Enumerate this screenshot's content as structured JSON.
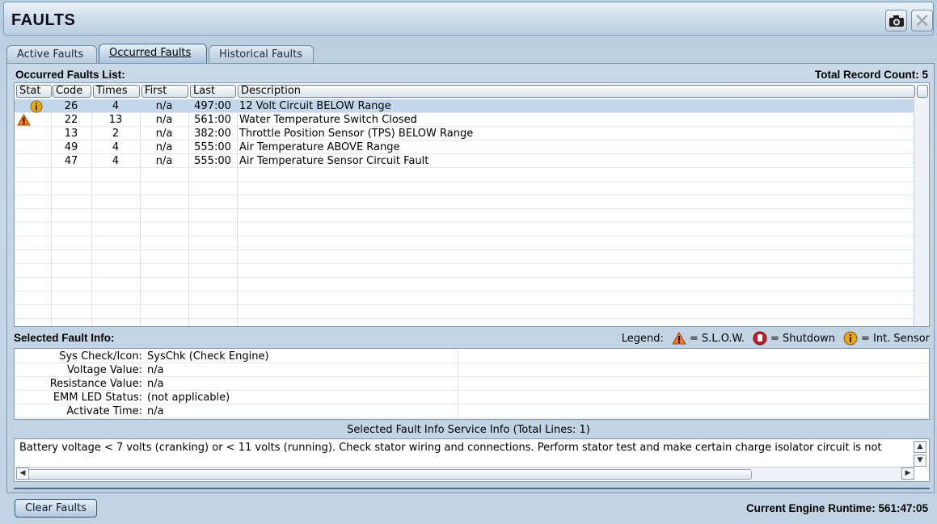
{
  "window": {
    "title": "FAULTS",
    "camera_icon": "camera-icon",
    "close_icon": "close-icon"
  },
  "tabs": [
    {
      "label": "Active Faults",
      "active": false
    },
    {
      "label": "Occurred Faults",
      "active": true
    },
    {
      "label": "Historical Faults",
      "active": false
    }
  ],
  "list": {
    "label": "Occurred Faults List:",
    "total_record_count": "Total Record Count: 5",
    "columns": [
      "Stat",
      "Code",
      "Times",
      "First",
      "Last",
      "Description"
    ],
    "rows": [
      {
        "stat_icon": "int-sensor-icon",
        "code": "26",
        "times": "4",
        "first": "n/a",
        "last": "497:00",
        "description": "12 Volt Circuit BELOW Range",
        "selected": true
      },
      {
        "stat_icon": "slow-warning-icon",
        "code": "22",
        "times": "13",
        "first": "n/a",
        "last": "561:00",
        "description": "Water Temperature Switch Closed",
        "selected": false
      },
      {
        "stat_icon": "",
        "code": "13",
        "times": "2",
        "first": "n/a",
        "last": "382:00",
        "description": "Throttle Position Sensor (TPS) BELOW Range",
        "selected": false
      },
      {
        "stat_icon": "",
        "code": "49",
        "times": "4",
        "first": "n/a",
        "last": "555:00",
        "description": "Air Temperature ABOVE Range",
        "selected": false
      },
      {
        "stat_icon": "",
        "code": "47",
        "times": "4",
        "first": "n/a",
        "last": "555:00",
        "description": "Air Temperature Sensor Circuit Fault",
        "selected": false
      }
    ]
  },
  "selected_info": {
    "label": "Selected Fault Info:",
    "legend": {
      "label": "Legend:",
      "slow": "= S.L.O.W.",
      "shutdown": "= Shutdown",
      "int_sensor": "= Int. Sensor"
    },
    "fields": [
      {
        "key": "Sys Check/Icon:",
        "value": "SysChk (Check Engine)"
      },
      {
        "key": "Voltage Value:",
        "value": "n/a"
      },
      {
        "key": "Resistance Value:",
        "value": "n/a"
      },
      {
        "key": "EMM LED Status:",
        "value": "(not applicable)"
      },
      {
        "key": "Activate Time:",
        "value": "n/a"
      }
    ]
  },
  "service_info": {
    "title": "Selected Fault Info Service Info (Total Lines: 1)",
    "text": "Battery voltage < 7 volts (cranking) or < 11 volts (running).  Check stator wiring and connections.  Perform stator test and make certain charge isolator circuit is not"
  },
  "footer": {
    "clear_button": "Clear Faults",
    "runtime": "Current Engine Runtime: 561:47:05"
  },
  "colors": {
    "selected_row": "#c2d7ea",
    "warning_orange": "#f07a1c",
    "info_yellow": "#e3a81c",
    "shutdown_red": "#c0202a"
  }
}
